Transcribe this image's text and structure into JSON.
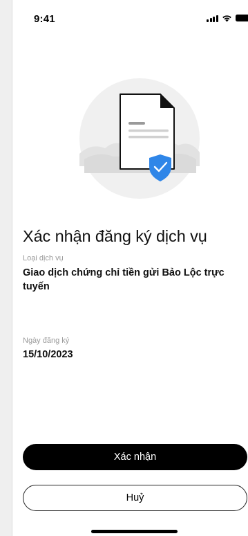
{
  "status_bar": {
    "time": "9:41",
    "icons": [
      "signal-icon",
      "wifi-icon",
      "battery-icon"
    ]
  },
  "illustration": {
    "icons": [
      "document-icon",
      "shield-check-icon"
    ],
    "accent_color": "#2f86e8"
  },
  "page_title": "Xác nhận đăng ký dịch vụ",
  "fields": {
    "service_type": {
      "label": "Loại dịch vụ",
      "value": "Giao dịch chứng chỉ tiền gửi Bảo Lộc trực tuyến"
    },
    "registration_date": {
      "label": "Ngày đăng ký",
      "value": "15/10/2023"
    }
  },
  "actions": {
    "confirm_label": "Xác nhận",
    "cancel_label": "Huỷ"
  },
  "colors": {
    "primary_button": "#000000",
    "label_gray": "#9a9a9a"
  }
}
